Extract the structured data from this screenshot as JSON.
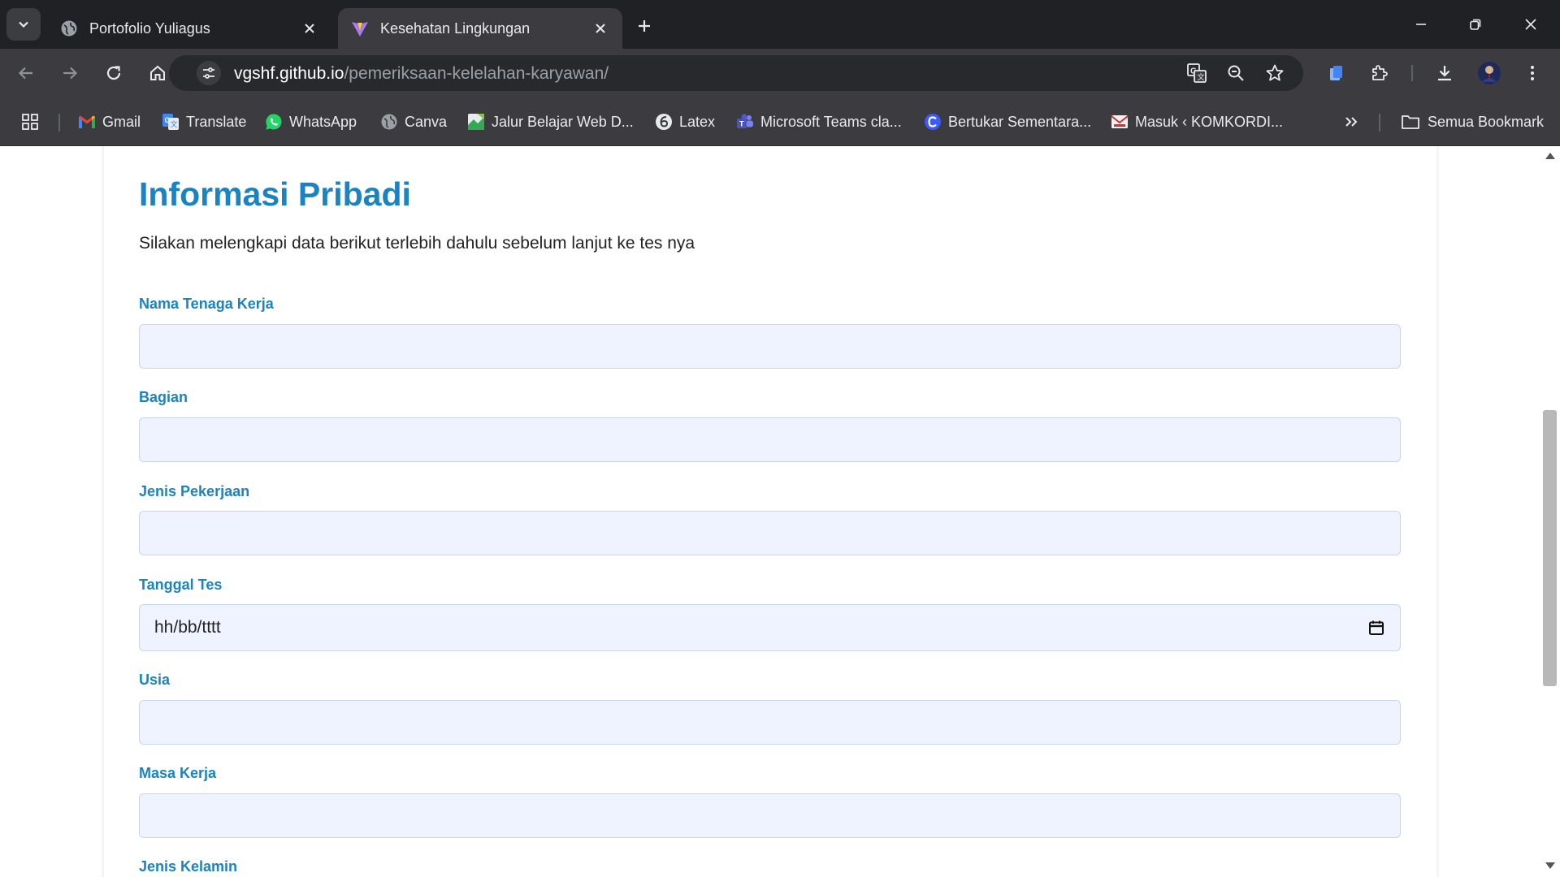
{
  "browser": {
    "tabs": [
      {
        "title": "Portofolio Yuliagus",
        "active": false
      },
      {
        "title": "Kesehatan Lingkungan",
        "active": true
      }
    ],
    "url": {
      "host": "vgshf.github.io",
      "path": "/pemeriksaan-kelelahan-karyawan/"
    },
    "bookmarks": [
      {
        "label": "Gmail",
        "icon": "gmail-icon"
      },
      {
        "label": "Translate",
        "icon": "translate-icon"
      },
      {
        "label": "WhatsApp",
        "icon": "whatsapp-icon"
      },
      {
        "label": "Canva",
        "icon": "globe-icon"
      },
      {
        "label": "Jalur Belajar Web D...",
        "icon": "bookmark-page-icon"
      },
      {
        "label": "Latex",
        "icon": "latex-icon"
      },
      {
        "label": "Microsoft Teams cla...",
        "icon": "teams-icon"
      },
      {
        "label": "Bertukar Sementara...",
        "icon": "c-logo-icon"
      },
      {
        "label": "Masuk ‹ KOMKORDI...",
        "icon": "mail-icon"
      }
    ],
    "all_bookmarks": "Semua Bookmark"
  },
  "form": {
    "title": "Informasi Pribadi",
    "subtitle": "Silakan melengkapi data berikut terlebih dahulu sebelum lanjut ke tes nya",
    "fields": {
      "nama": {
        "label": "Nama Tenaga Kerja",
        "value": ""
      },
      "bagian": {
        "label": "Bagian",
        "value": ""
      },
      "jenis_pekerjaan": {
        "label": "Jenis Pekerjaan",
        "value": ""
      },
      "tanggal_tes": {
        "label": "Tanggal Tes",
        "placeholder": "hh/bb/tttt"
      },
      "usia": {
        "label": "Usia",
        "value": ""
      },
      "masa_kerja": {
        "label": "Masa Kerja",
        "value": ""
      },
      "jenis_kelamin": {
        "label": "Jenis Kelamin"
      }
    }
  },
  "colors": {
    "accent": "#1a83c2",
    "field_bg": "#eef3ff",
    "field_border": "#c9d5ee"
  }
}
